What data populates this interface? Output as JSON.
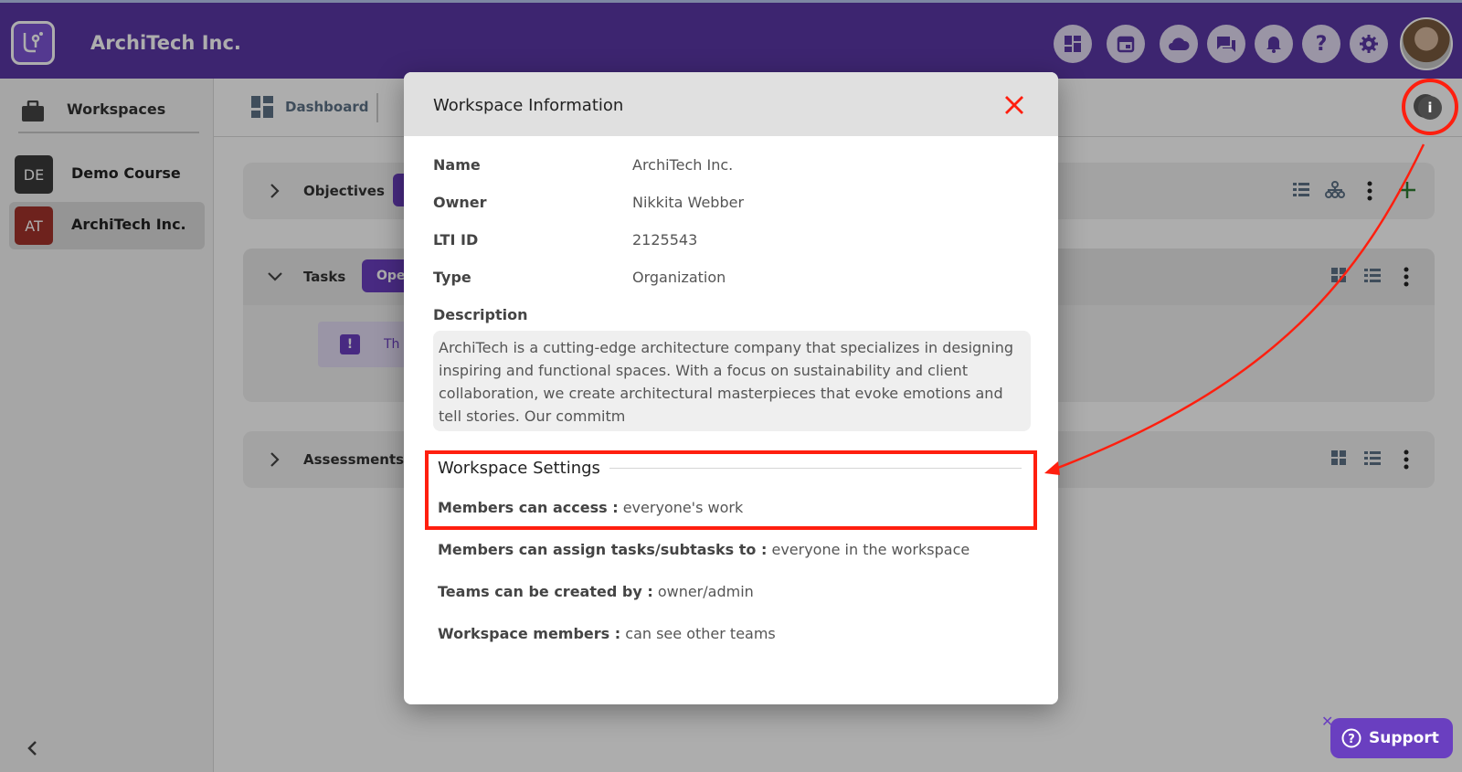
{
  "app": {
    "brand": "ArchiTech Inc.",
    "top_icons": [
      "dashboard-icon",
      "calendar-icon",
      "cloud-icon",
      "chat-icon",
      "bell-icon",
      "help-icon",
      "gear-icon"
    ]
  },
  "sidebar": {
    "header": "Workspaces",
    "items": [
      {
        "badge": "DE",
        "label": "Demo Course",
        "color": "#3a3a3a"
      },
      {
        "badge": "AT",
        "label": "ArchiTech Inc.",
        "color": "#a3332b"
      }
    ]
  },
  "toolbar": {
    "dashboard_label": "Dashboard"
  },
  "cards": {
    "objectives": {
      "title": "Objectives"
    },
    "tasks": {
      "title": "Tasks",
      "pill": "Ope",
      "notice_text": "Th"
    },
    "assessments": {
      "title": "Assessments"
    }
  },
  "modal": {
    "title": "Workspace Information",
    "fields": {
      "name_label": "Name",
      "name_value": "ArchiTech Inc.",
      "owner_label": "Owner",
      "owner_value": "Nikkita Webber",
      "lti_label": "LTI ID",
      "lti_value": "2125543",
      "type_label": "Type",
      "type_value": "Organization",
      "description_label": "Description",
      "description_value": "ArchiTech is a cutting-edge architecture company that specializes in designing inspiring and functional spaces. With a focus on sustainability and client collaboration, we create architectural masterpieces that evoke emotions and tell stories. Our commitm"
    },
    "settings": {
      "title": "Workspace Settings",
      "items": [
        {
          "label": "Members can access :",
          "value": "everyone's work"
        },
        {
          "label": "Members can assign tasks/subtasks to :",
          "value": "everyone in the workspace"
        },
        {
          "label": "Teams can be created by :",
          "value": "owner/admin"
        },
        {
          "label": "Workspace members :",
          "value": "can see other teams"
        }
      ]
    }
  },
  "support": {
    "label": "Support"
  },
  "colors": {
    "brand": "#5a37a6",
    "accent": "#6a3fc0",
    "annotation": "#ff1f0f"
  }
}
